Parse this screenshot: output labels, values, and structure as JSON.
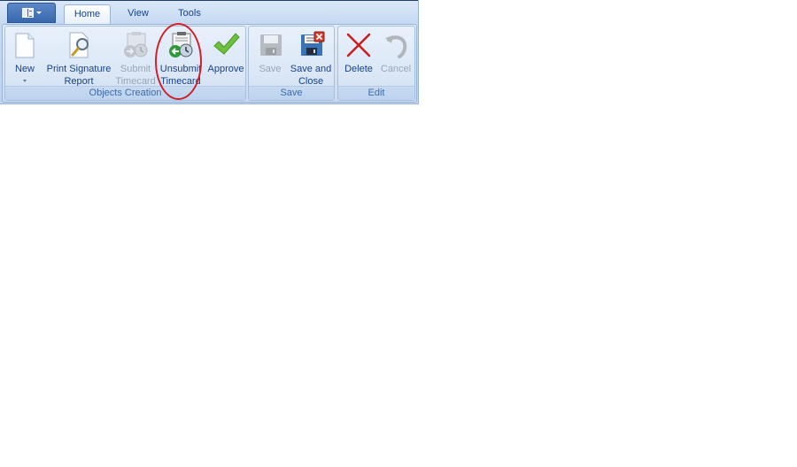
{
  "app_menu": {
    "icon": "app-menu-icon"
  },
  "tabs": [
    {
      "label": "Home",
      "active": true
    },
    {
      "label": "View",
      "active": false
    },
    {
      "label": "Tools",
      "active": false
    }
  ],
  "groups": [
    {
      "label": "Objects Creation",
      "buttons": [
        {
          "label": "New",
          "icon": "new-document-icon",
          "enabled": true,
          "has_dropdown": true
        },
        {
          "label": "Print Signature\nReport",
          "icon": "print-preview-icon",
          "enabled": true
        },
        {
          "label": "Submit\nTimecard",
          "icon": "submit-timecard-icon",
          "enabled": false
        },
        {
          "label": "Unsubmit\nTimecard",
          "icon": "unsubmit-timecard-icon",
          "enabled": true,
          "highlighted": true
        },
        {
          "label": "Approve",
          "icon": "checkmark-icon",
          "enabled": true
        }
      ]
    },
    {
      "label": "Save",
      "buttons": [
        {
          "label": "Save",
          "icon": "save-icon",
          "enabled": false
        },
        {
          "label": "Save and\nClose",
          "icon": "save-close-icon",
          "enabled": true
        }
      ]
    },
    {
      "label": "Edit",
      "buttons": [
        {
          "label": "Delete",
          "icon": "delete-icon",
          "enabled": true
        },
        {
          "label": "Cancel",
          "icon": "undo-icon",
          "enabled": false
        }
      ]
    }
  ],
  "colors": {
    "highlight": "#d0202a",
    "text": "#15428b",
    "disabled_text": "#98a6b8",
    "group_label": "#3e6aaa"
  }
}
